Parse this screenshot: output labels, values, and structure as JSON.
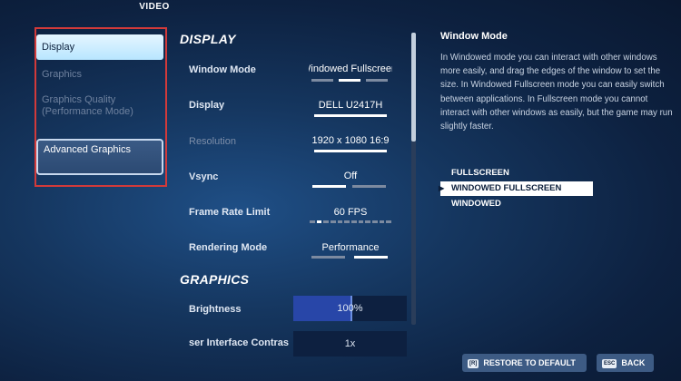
{
  "header": {
    "title": "VIDEO"
  },
  "menu": {
    "items": [
      {
        "label": "Display"
      },
      {
        "label": "Graphics"
      },
      {
        "label": "Graphics Quality (Performance Mode)"
      },
      {
        "label": "Advanced Graphics"
      }
    ]
  },
  "display": {
    "heading": "DISPLAY",
    "window_mode": {
      "label": "Window Mode",
      "value": "Windowed Fullscreen",
      "segments": 3,
      "selected": 1
    },
    "display": {
      "label": "Display",
      "value": "DELL U2417H"
    },
    "resolution": {
      "label": "Resolution",
      "value": "1920 x 1080 16:9"
    },
    "vsync": {
      "label": "Vsync",
      "value": "Off",
      "segments": 2,
      "selected": 0
    },
    "frame_rate": {
      "label": "Frame Rate Limit",
      "value": "60 FPS",
      "segments": 12,
      "selected": 1
    },
    "rendering_mode": {
      "label": "Rendering Mode",
      "value": "Performance",
      "segments": 2,
      "selected": 1
    }
  },
  "graphics": {
    "heading": "GRAPHICS",
    "brightness": {
      "label": "Brightness",
      "value": "100%",
      "fraction": 0.5
    },
    "ui_contrast": {
      "label": "ser Interface Contras",
      "value": "1x"
    }
  },
  "description": {
    "title": "Window Mode",
    "text": "In Windowed mode you can interact with other windows more easily, and drag the edges of the window to set the size. In Windowed Fullscreen mode you can easily switch between applications. In Fullscreen mode you cannot interact with other windows as easily, but the game may run slightly faster."
  },
  "options": {
    "items": [
      "FULLSCREEN",
      "WINDOWED FULLSCREEN",
      "WINDOWED"
    ],
    "selected": 1
  },
  "footer": {
    "restore": {
      "key": "[R]",
      "label": "RESTORE TO DEFAULT"
    },
    "back": {
      "key": "ESC",
      "label": "BACK"
    }
  }
}
